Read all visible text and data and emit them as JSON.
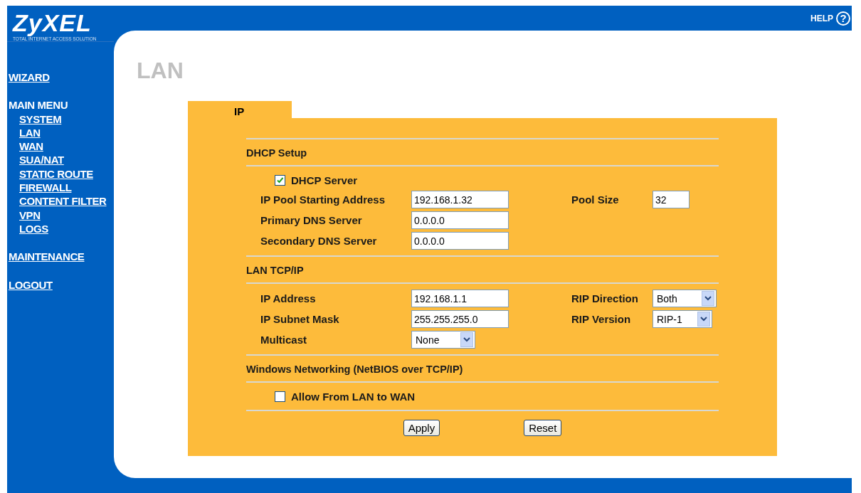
{
  "logo": {
    "name": "ZyXEL",
    "tagline": "TOTAL INTERNET ACCESS SOLUTION"
  },
  "help": {
    "label": "HELP",
    "icon": "?"
  },
  "sidebar": {
    "items": [
      {
        "label": "WIZARD",
        "kind": "link"
      },
      {
        "label": "MAIN MENU",
        "kind": "heading",
        "children": [
          {
            "label": "SYSTEM"
          },
          {
            "label": "LAN"
          },
          {
            "label": "WAN"
          },
          {
            "label": "SUA/NAT"
          },
          {
            "label": "STATIC ROUTE"
          },
          {
            "label": "FIREWALL"
          },
          {
            "label": "CONTENT FILTER"
          },
          {
            "label": "VPN"
          },
          {
            "label": "LOGS"
          }
        ]
      },
      {
        "label": "MAINTENANCE",
        "kind": "link"
      },
      {
        "label": "LOGOUT",
        "kind": "link"
      }
    ]
  },
  "page_title": "LAN",
  "tabs": [
    {
      "label": "IP",
      "selected": true
    }
  ],
  "sections": [
    {
      "title": "DHCP Setup",
      "checkbox": {
        "label": "DHCP Server",
        "checked": true
      },
      "rows": [
        {
          "label": "IP Pool Starting Address",
          "field": {
            "kind": "text",
            "value": "192.168.1.32"
          },
          "right_label": "Pool Size",
          "right_field": {
            "kind": "short",
            "value": "32"
          }
        },
        {
          "label": "Primary DNS Server",
          "field": {
            "kind": "text",
            "value": "0.0.0.0"
          }
        },
        {
          "label": "Secondary DNS Server",
          "field": {
            "kind": "text",
            "value": "0.0.0.0"
          }
        }
      ]
    },
    {
      "title": "LAN TCP/IP",
      "rows": [
        {
          "label": "IP Address",
          "field": {
            "kind": "text",
            "value": "192.168.1.1"
          },
          "right_label": "RIP Direction",
          "right_field": {
            "kind": "select",
            "value": "Both"
          }
        },
        {
          "label": "IP Subnet Mask",
          "field": {
            "kind": "text",
            "value": "255.255.255.0"
          },
          "right_label": "RIP Version",
          "right_field": {
            "kind": "select",
            "value": "RIP-1"
          }
        },
        {
          "label": "Multicast",
          "field": {
            "kind": "select",
            "value": "None"
          }
        }
      ]
    },
    {
      "title": "Windows Networking (NetBIOS over TCP/IP)",
      "checkbox": {
        "label": "Allow From LAN to WAN",
        "checked": false
      }
    }
  ],
  "buttons": [
    "Apply",
    "Reset"
  ]
}
